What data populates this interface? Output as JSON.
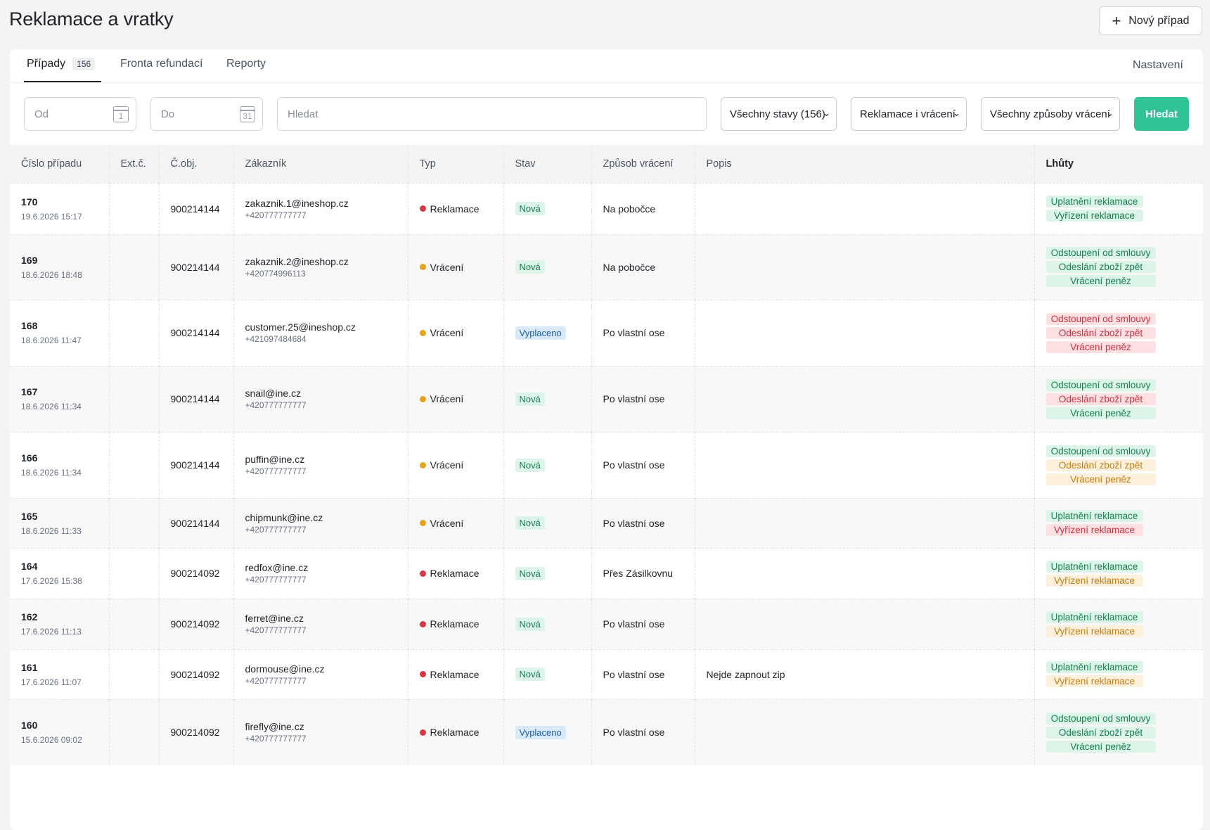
{
  "header": {
    "title": "Reklamace a vratky",
    "new_case_label": "Nový případ"
  },
  "tabs": [
    {
      "label": "Případy",
      "count": "156",
      "active": true
    },
    {
      "label": "Fronta refundací"
    },
    {
      "label": "Reporty"
    }
  ],
  "settings_label": "Nastavení",
  "filters": {
    "from_placeholder": "Od",
    "to_placeholder": "Do",
    "calendar_from_day": "1",
    "calendar_to_day": "31",
    "search_placeholder": "Hledat",
    "status_select": "Všechny stavy (156)",
    "type_select": "Reklamace i vrácení",
    "method_select": "Všechny způsoby vrácení",
    "search_button": "Hledat"
  },
  "table": {
    "columns": [
      "Číslo případu",
      "Ext.č.",
      "Č.obj.",
      "Zákazník",
      "Typ",
      "Stav",
      "Způsob vrácení",
      "Popis",
      "Lhůty"
    ],
    "rows": [
      {
        "id": "170",
        "date": "19.6.2026 15:17",
        "ext": "",
        "order": "900214144",
        "email": "zakaznik.1@ineshop.cz",
        "phone": "+420777777777",
        "type": "Reklamace",
        "type_color": "#dc3545",
        "status": "Nová",
        "status_kind": "nova",
        "method": "Na pobočce",
        "desc": "",
        "deadlines": [
          {
            "label": "Uplatnění reklamace",
            "color": "green"
          },
          {
            "label": "Vyřízení reklamace",
            "color": "green"
          }
        ]
      },
      {
        "id": "169",
        "date": "18.6.2026 18:48",
        "ext": "",
        "order": "900214144",
        "email": "zakaznik.2@ineshop.cz",
        "phone": "+420774996113",
        "type": "Vrácení",
        "type_color": "#e8a317",
        "status": "Nová",
        "status_kind": "nova",
        "method": "Na pobočce",
        "desc": "",
        "deadlines": [
          {
            "label": "Odstoupení od smlouvy",
            "color": "green"
          },
          {
            "label": "Odeslání zboží zpět",
            "color": "green"
          },
          {
            "label": "Vrácení peněz",
            "color": "green"
          }
        ]
      },
      {
        "id": "168",
        "date": "18.6.2026 11:47",
        "ext": "",
        "order": "900214144",
        "email": "customer.25@ineshop.cz",
        "phone": "+421097484684",
        "type": "Vrácení",
        "type_color": "#e8a317",
        "status": "Vyplaceno",
        "status_kind": "vyplaceno",
        "method": "Po vlastní ose",
        "desc": "",
        "deadlines": [
          {
            "label": "Odstoupení od smlouvy",
            "color": "red"
          },
          {
            "label": "Odeslání zboží zpět",
            "color": "red"
          },
          {
            "label": "Vrácení peněz",
            "color": "red"
          }
        ]
      },
      {
        "id": "167",
        "date": "18.6.2026 11:34",
        "ext": "",
        "order": "900214144",
        "email": "snail@ine.cz",
        "phone": "+420777777777",
        "type": "Vrácení",
        "type_color": "#e8a317",
        "status": "Nová",
        "status_kind": "nova",
        "method": "Po vlastní ose",
        "desc": "",
        "deadlines": [
          {
            "label": "Odstoupení od smlouvy",
            "color": "green"
          },
          {
            "label": "Odeslání zboží zpět",
            "color": "red"
          },
          {
            "label": "Vrácení peněz",
            "color": "green"
          }
        ]
      },
      {
        "id": "166",
        "date": "18.6.2026 11:34",
        "ext": "",
        "order": "900214144",
        "email": "puffin@ine.cz",
        "phone": "+420777777777",
        "type": "Vrácení",
        "type_color": "#e8a317",
        "status": "Nová",
        "status_kind": "nova",
        "method": "Po vlastní ose",
        "desc": "",
        "deadlines": [
          {
            "label": "Odstoupení od smlouvy",
            "color": "green"
          },
          {
            "label": "Odeslání zboží zpět",
            "color": "orange"
          },
          {
            "label": "Vrácení peněz",
            "color": "orange"
          }
        ]
      },
      {
        "id": "165",
        "date": "18.6.2026 11:33",
        "ext": "",
        "order": "900214144",
        "email": "chipmunk@ine.cz",
        "phone": "+420777777777",
        "type": "Vrácení",
        "type_color": "#e8a317",
        "status": "Nová",
        "status_kind": "nova",
        "method": "Po vlastní ose",
        "desc": "",
        "deadlines": [
          {
            "label": "Uplatnění reklamace",
            "color": "green"
          },
          {
            "label": "Vyřízení reklamace",
            "color": "red"
          }
        ]
      },
      {
        "id": "164",
        "date": "17.6.2026 15:38",
        "ext": "",
        "order": "900214092",
        "email": "redfox@ine.cz",
        "phone": "+420777777777",
        "type": "Reklamace",
        "type_color": "#dc3545",
        "status": "Nová",
        "status_kind": "nova",
        "method": "Přes Zásilkovnu",
        "desc": "",
        "deadlines": [
          {
            "label": "Uplatnění reklamace",
            "color": "green"
          },
          {
            "label": "Vyřízení reklamace",
            "color": "orange"
          }
        ]
      },
      {
        "id": "162",
        "date": "17.6.2026 11:13",
        "ext": "",
        "order": "900214092",
        "email": "ferret@ine.cz",
        "phone": "+420777777777",
        "type": "Reklamace",
        "type_color": "#dc3545",
        "status": "Nová",
        "status_kind": "nova",
        "method": "Po vlastní ose",
        "desc": "",
        "deadlines": [
          {
            "label": "Uplatnění reklamace",
            "color": "green"
          },
          {
            "label": "Vyřízení reklamace",
            "color": "orange"
          }
        ]
      },
      {
        "id": "161",
        "date": "17.6.2026 11:07",
        "ext": "",
        "order": "900214092",
        "email": "dormouse@ine.cz",
        "phone": "+420777777777",
        "type": "Reklamace",
        "type_color": "#dc3545",
        "status": "Nová",
        "status_kind": "nova",
        "method": "Po vlastní ose",
        "desc": "Nejde zapnout zip",
        "deadlines": [
          {
            "label": "Uplatnění reklamace",
            "color": "green"
          },
          {
            "label": "Vyřízení reklamace",
            "color": "orange"
          }
        ]
      },
      {
        "id": "160",
        "date": "15.6.2026 09:02",
        "ext": "",
        "order": "900214092",
        "email": "firefly@ine.cz",
        "phone": "+420777777777",
        "type": "Reklamace",
        "type_color": "#dc3545",
        "status": "Vyplaceno",
        "status_kind": "vyplaceno",
        "method": "Po vlastní ose",
        "desc": "",
        "deadlines": [
          {
            "label": "Odstoupení od smlouvy",
            "color": "green"
          },
          {
            "label": "Odeslání zboží zpět",
            "color": "green"
          },
          {
            "label": "Vrácení peněz",
            "color": "green"
          }
        ]
      }
    ]
  },
  "colors": {
    "accent": "#2ec496",
    "reklamace_dot": "#dc3545",
    "vraceni_dot": "#e8a317"
  }
}
